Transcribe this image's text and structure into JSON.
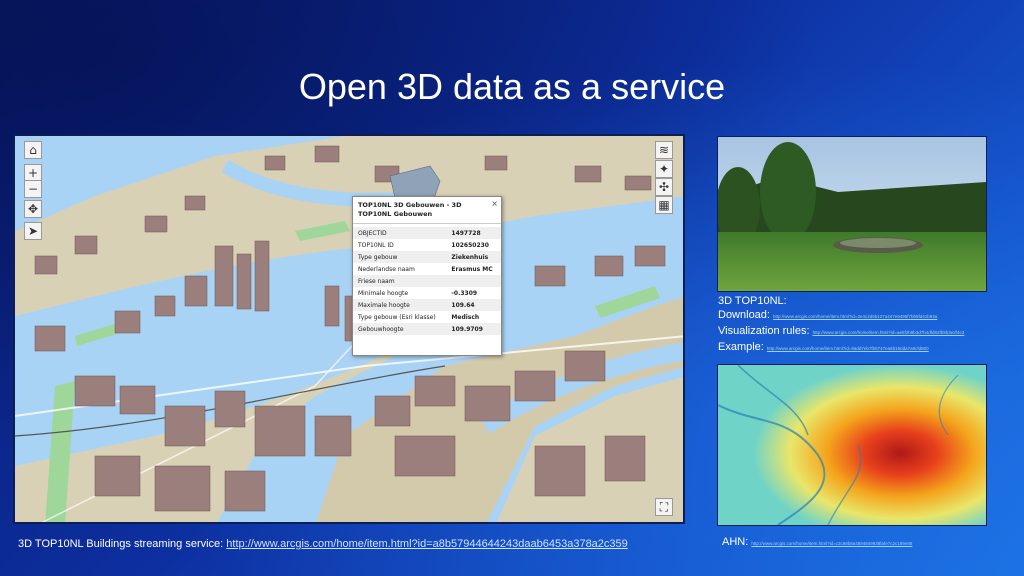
{
  "slide": {
    "title": "Open 3D data as a service"
  },
  "map": {
    "controls_left": [
      "home-icon",
      "zoom-in-icon",
      "zoom-out-icon",
      "pan-icon",
      "compass-icon"
    ],
    "controls_right": [
      "layers-icon",
      "navigate-icon",
      "move-icon",
      "basemap-icon"
    ],
    "popup": {
      "title": "TOP10NL 3D Gebouwen - 3D TOP10NL Gebouwen",
      "close": "×",
      "rows": [
        {
          "label": "OBJECTID",
          "value": "1497728"
        },
        {
          "label": "TOP10NL ID",
          "value": "102650230"
        },
        {
          "label": "Type gebouw",
          "value": "Ziekenhuis"
        },
        {
          "label": "Nederlandse naam",
          "value": "Erasmus MC"
        },
        {
          "label": "Friese naam",
          "value": ""
        },
        {
          "label": "Minimale hoogte",
          "value": "-0.3309"
        },
        {
          "label": "Maximale hoogte",
          "value": "109.64"
        },
        {
          "label": "Type gebouw (Esri klasse)",
          "value": "Medisch"
        },
        {
          "label": "Gebouwhoogte",
          "value": "109.9709"
        }
      ]
    }
  },
  "info": {
    "heading": "3D TOP10NL:",
    "download_label": "Download:",
    "download_link": "http://www.arcgis.com/home/item.html?id=2e4c2d5b127a447e9495f7bb5fd41b93a",
    "visualization_label": "Visualization rules:",
    "visualization_link": "http://www.arcgis.com/home/item.html?id=ae5f2b9b3d7b4dfd82fb9b3e2f4c3",
    "example_label": "Example:",
    "example_link": "http://www.arcgis.com/home/item.html?id=9add7eb7fb8747ea6b18dda7a9cfd800"
  },
  "captions": {
    "left_label": "3D TOP10NL Buildings streaming service:",
    "left_link": "http://www.arcgis.com/home/item.html?id=a8b57944644243daab6453a378a2c359",
    "right_label": "AHN:",
    "right_link": "http://www.arcgis.com/home/item.html?id=c3c98b8a4894849938fafe7c2c189e88"
  }
}
